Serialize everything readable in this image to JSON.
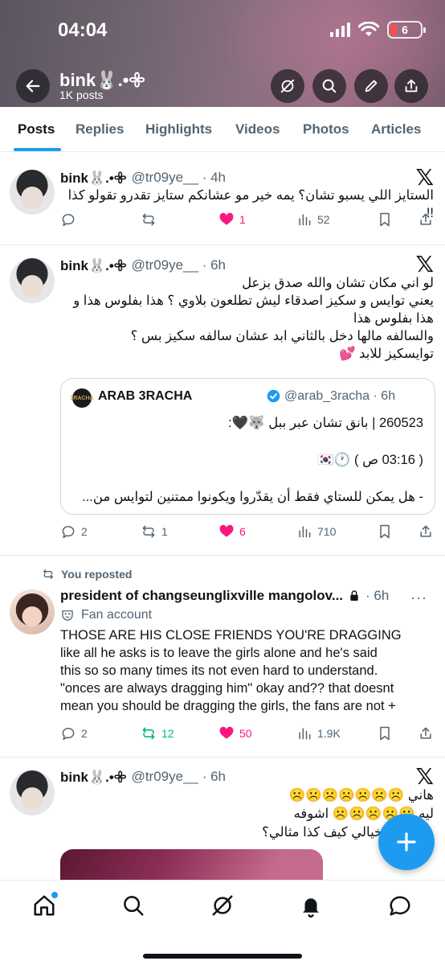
{
  "status_bar": {
    "time": "04:04",
    "battery": "6"
  },
  "header": {
    "title": "bink🐰.•𖧷",
    "subtitle": "1K posts",
    "icons": [
      "back-arrow-icon",
      "grok-icon",
      "search-icon",
      "edit-icon",
      "share-icon"
    ]
  },
  "tabs": [
    {
      "label": "Posts",
      "active": true
    },
    {
      "label": "Replies"
    },
    {
      "label": "Highlights"
    },
    {
      "label": "Videos"
    },
    {
      "label": "Photos"
    },
    {
      "label": "Articles"
    }
  ],
  "tweets": [
    {
      "name": "bink🐰.•𖧷",
      "handle": "@tr09ye__ · 4h",
      "text": "الستايز اللي يسبو تشان؟ يمه خير مو عشانكم ستايز تقدرو تقولو كذا !!",
      "replies": "",
      "retweets": "",
      "likes": "1",
      "views": "52"
    },
    {
      "name": "bink🐰.•𖧷",
      "handle": "@tr09ye__ · 6h",
      "text": "لو اني مكان تشان والله صدق بزعل\nيعني توايس و سكيز اصدقاء ليش تطلعون بلاوي ؟ هذا بفلوس هذا و هذا بفلوس هذا\nوالسالفه مالها دخل بالثاني ابد عشان سالفه سكيز بس ؟\nتوايسكيز للابد 💕",
      "quote": {
        "avatar_text": "3RACHA",
        "name": "ARAB 3RACHA",
        "handle": "@arab_3racha · 6h",
        "line1": "260523 | بانق تشان عبر ببل 🐺🖤:",
        "line2": "( 03:16 ص ) 🕐🇰🇷",
        "line3": "- هل يمكن للستاي فقط أن يقدّروا ويكونوا ممتنين لتوايس من..."
      },
      "replies": "2",
      "retweets": "1",
      "likes": "6",
      "views": "710"
    },
    {
      "repost_label": "You reposted",
      "name": "president of changseunglixville mangolov...",
      "handle": "· 6h",
      "badge": "Fan account",
      "text": "THOSE ARE HIS CLOSE FRIENDS YOU'RE DRAGGING\nlike all he asks is to leave the girls alone and he's said\nthis so so many times its not even hard to understand.\n\"onces are always dragging him\" okay and?? that doesnt\nmean you should be dragging the girls, the fans are not +",
      "replies": "2",
      "retweets": "12",
      "likes": "50",
      "views": "1.9K"
    },
    {
      "name": "bink🐰.•𖧷",
      "handle": "@tr09ye__ · 6h",
      "line1": "هاني ☹️☹️☹️☹️☹️☹️☹️",
      "line2": "ليه ☹️☹️☹️☹️☹️ اشوفه",
      "line3": "وصوتههه خيالي كيف كذا مثالي؟"
    }
  ],
  "bottom_nav": [
    "home-icon",
    "search-icon",
    "grok-icon",
    "notifications-icon",
    "messages-icon"
  ],
  "colors": {
    "accent": "#1d9bf0",
    "like": "#f91880",
    "retweet": "#00ba7c",
    "secondary": "#536471"
  }
}
